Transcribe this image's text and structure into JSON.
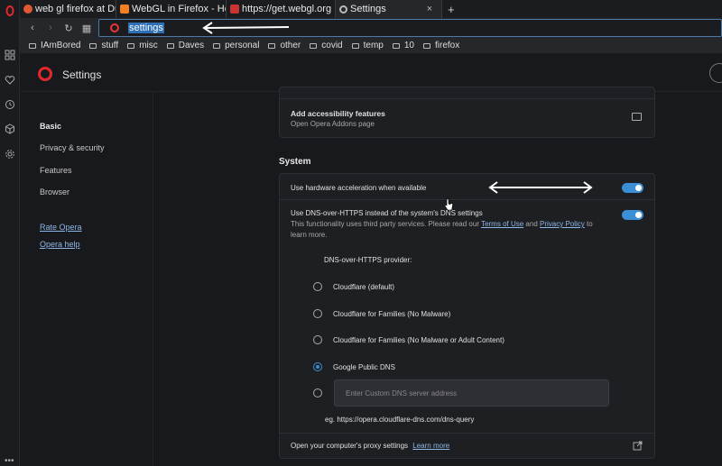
{
  "tabs": [
    {
      "label": "web gl firefox at Duck",
      "fav_color": "#de5833",
      "active": false
    },
    {
      "label": "WebGL in Firefox - He",
      "fav_color": "#f48024",
      "active": false
    },
    {
      "label": "https://get.webgl.org",
      "fav_color": "#cc3333",
      "active": false
    },
    {
      "label": "Settings",
      "fav_color": "#bbbbbb",
      "active": true
    }
  ],
  "tab_close": "×",
  "tab_new": "+",
  "nav": {
    "back": "‹",
    "forward": "›",
    "reload": "↻",
    "grid": "▦"
  },
  "address": {
    "value": "settings"
  },
  "bookmarks": [
    "IAmBored",
    "stuff",
    "misc",
    "Daves",
    "personal",
    "other",
    "covid",
    "temp",
    "10",
    "firefox"
  ],
  "header": {
    "title": "Settings"
  },
  "sidebar": {
    "items": [
      "Basic",
      "Privacy & security",
      "Features",
      "Browser"
    ],
    "links": [
      "Rate Opera",
      "Opera help"
    ]
  },
  "top_card": {
    "title": "Add accessibility features",
    "subtitle": "Open Opera Addons page"
  },
  "system": {
    "section_title": "System",
    "hw_accel_label": "Use hardware acceleration when available",
    "doh_label": "Use DNS-over-HTTPS instead of the system's DNS settings",
    "doh_desc_1": "This functionality uses third party services. Please read our",
    "doh_terms": "Terms of Use",
    "doh_and": "and",
    "doh_privacy": "Privacy Policy",
    "doh_to": "to",
    "doh_desc_2": "learn more.",
    "provider_label": "DNS-over-HTTPS provider:",
    "providers": [
      {
        "label": "Cloudflare (default)",
        "selected": false
      },
      {
        "label": "Cloudflare for Families (No Malware)",
        "selected": false
      },
      {
        "label": "Cloudflare for Families (No Malware or Adult Content)",
        "selected": false
      },
      {
        "label": "Google Public DNS",
        "selected": true
      }
    ],
    "custom_placeholder": "Enter Custom DNS server address",
    "example": "eg. https://opera.cloudflare-dns.com/dns-query",
    "proxy_label": "Open your computer's proxy settings",
    "proxy_link": "Learn more"
  },
  "colors": {
    "accent": "#3a8fd6",
    "opera_red": "#e0282d",
    "link": "#8fb8e8"
  }
}
